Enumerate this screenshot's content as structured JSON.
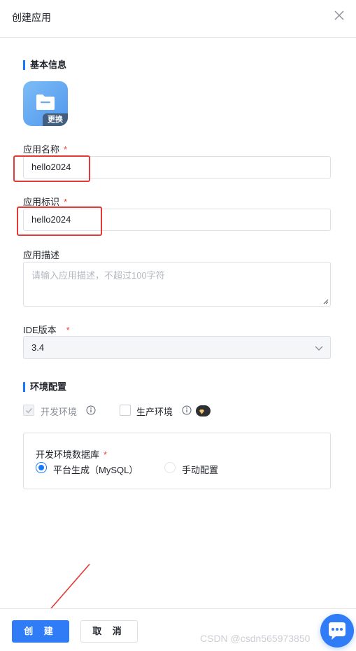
{
  "dialog": {
    "title": "创建应用"
  },
  "basic": {
    "section_title": "基本信息",
    "icon_change_label": "更换",
    "app_name_label": "应用名称",
    "app_name_value": "hello2024",
    "app_id_label": "应用标识",
    "app_id_value": "hello2024",
    "desc_label": "应用描述",
    "desc_placeholder": "请输入应用描述，不超过100字符",
    "ide_label": "IDE版本",
    "ide_value": "3.4",
    "required_mark": "*"
  },
  "env": {
    "section_title": "环境配置",
    "dev_label": "开发环境",
    "prod_label": "生产环境",
    "pro_badge": "专业版",
    "dev_checked": true,
    "prod_checked": false,
    "db_label": "开发环境数据库",
    "db_option_auto": "平台生成（MySQL）",
    "db_option_manual": "手动配置",
    "db_selected": "auto"
  },
  "footer": {
    "create_label": "创 建",
    "cancel_label": "取 消"
  },
  "watermark": "CSDN @csdn565973850",
  "colors": {
    "primary": "#2f7cf6",
    "annotation_red": "#e53935",
    "required": "#f04438"
  }
}
